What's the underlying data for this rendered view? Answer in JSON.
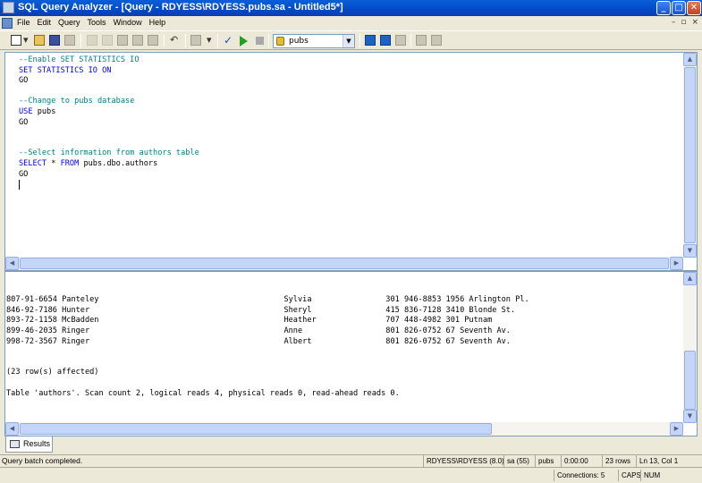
{
  "window": {
    "title": "SQL Query Analyzer - [Query - RDYESS\\RDYESS.pubs.sa - Untitled5*]",
    "minimize": "_",
    "maximize": "□",
    "close": "✕"
  },
  "menu": {
    "items": [
      "File",
      "Edit",
      "Query",
      "Tools",
      "Window",
      "Help"
    ],
    "mdi_buttons": [
      "–",
      "▫",
      "×"
    ]
  },
  "toolbar": {
    "database": "pubs"
  },
  "editor": {
    "lines": [
      [
        {
          "t": "--Enable SET STATISTICS IO",
          "c": "cm"
        }
      ],
      [
        {
          "t": "SET STATISTICS IO ON",
          "c": "kw"
        }
      ],
      [
        {
          "t": "GO",
          "c": ""
        }
      ],
      [
        {
          "t": "",
          "c": ""
        }
      ],
      [
        {
          "t": "--Change to pubs database",
          "c": "cm"
        }
      ],
      [
        {
          "t": "USE",
          "c": "kw"
        },
        {
          "t": " pubs",
          "c": ""
        }
      ],
      [
        {
          "t": "GO",
          "c": ""
        }
      ],
      [
        {
          "t": "",
          "c": ""
        }
      ],
      [
        {
          "t": "",
          "c": ""
        }
      ],
      [
        {
          "t": "--Select information from authors table",
          "c": "cm"
        }
      ],
      [
        {
          "t": "SELECT",
          "c": "kw"
        },
        {
          "t": " * ",
          "c": ""
        },
        {
          "t": "FROM",
          "c": "kw"
        },
        {
          "t": " pubs.dbo.authors",
          "c": ""
        }
      ],
      [
        {
          "t": "GO",
          "c": ""
        }
      ]
    ]
  },
  "results": {
    "rows": [
      [
        "807-91-6654",
        "Panteley",
        "Sylvia",
        "301 946-8853",
        "1956 Arlington Pl."
      ],
      [
        "846-92-7186",
        "Hunter",
        "Sheryl",
        "415 836-7128",
        "3410 Blonde St."
      ],
      [
        "893-72-1158",
        "McBadden",
        "Heather",
        "707 448-4982",
        "301 Putnam"
      ],
      [
        "899-46-2035",
        "Ringer",
        "Anne",
        "801 826-0752",
        "67 Seventh Av."
      ],
      [
        "998-72-3567",
        "Ringer",
        "Albert",
        "801 826-0752",
        "67 Seventh Av."
      ]
    ],
    "affected": "(23 row(s) affected)",
    "statistics": "Table 'authors'. Scan count 2, logical reads 4, physical reads 0, read-ahead reads 0."
  },
  "tabs": {
    "results_label": "Results"
  },
  "status": {
    "message": "Query batch completed.",
    "server": "RDYESS\\RDYESS (8.0)",
    "user": "sa (55)",
    "database": "pubs",
    "elapsed": "0:00:00",
    "rows": "23 rows",
    "position": "Ln 13, Col 1",
    "connections": "Connections: 5",
    "caps": "CAPS",
    "num": "NUM"
  }
}
